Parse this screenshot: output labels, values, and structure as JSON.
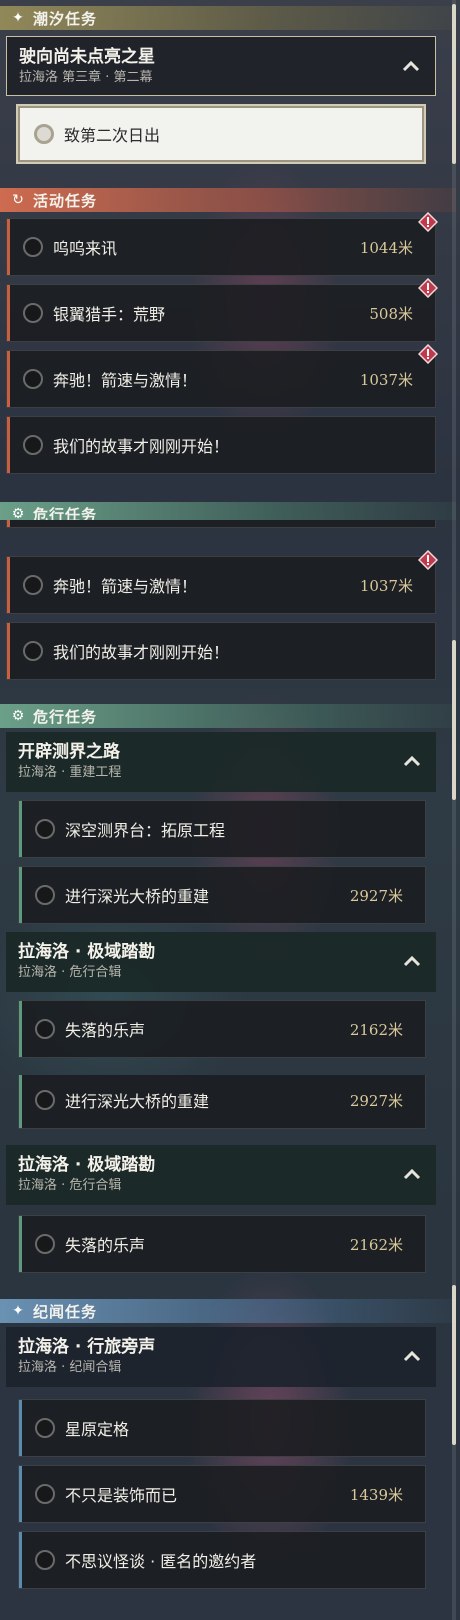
{
  "categories": {
    "tide": "潮汐任务",
    "event": "活动任务",
    "danger": "危行任务",
    "lore": "纪闻任务"
  },
  "tide_quest": {
    "title": "驶向尚未点亮之星",
    "subtitle": "拉海洛 第三章 · 第二幕",
    "step": "致第二次日出"
  },
  "event_quests": [
    {
      "name": "呜呜来讯",
      "distance": "1044米",
      "alert": true
    },
    {
      "name": "银翼猎手：荒野",
      "distance": "508米",
      "alert": true
    },
    {
      "name": "奔驰！箭速与激情！",
      "distance": "1037米",
      "alert": true
    },
    {
      "name": "我们的故事才刚刚开始！",
      "distance": "",
      "alert": false
    }
  ],
  "danger_groups": [
    {
      "title": "开辟测界之路",
      "subtitle": "拉海洛 · 重建工程",
      "items": [
        {
          "name": "深空测界台：拓原工程",
          "distance": ""
        },
        {
          "name": "进行深光大桥的重建",
          "distance": "2927米"
        }
      ]
    },
    {
      "title": "拉海洛 · 极域踏勘",
      "subtitle": "拉海洛 · 危行合辑",
      "items": [
        {
          "name": "失落的乐声",
          "distance": "2162米"
        }
      ]
    }
  ],
  "lore_group": {
    "title": "拉海洛 · 行旅旁声",
    "subtitle": "拉海洛 · 纪闻合辑",
    "items": [
      {
        "name": "星原定格",
        "distance": ""
      },
      {
        "name": "不只是装饰而已",
        "distance": "1439米"
      },
      {
        "name": "不思议怪谈 · 匿名的邀约者",
        "distance": ""
      }
    ]
  },
  "icons": {
    "tide": "sparkle-icon",
    "event": "refresh-icon",
    "danger": "hazard-icon",
    "lore": "sparkle-icon",
    "chevron": "chevron-up-icon",
    "alert": "alert-diamond-icon",
    "status": "circle-status-icon"
  },
  "colors": {
    "tide": "#968c5a",
    "event": "#d66e50",
    "danger": "#6ea58c",
    "lore": "#6e96b9",
    "distance": "#d8c89a"
  }
}
